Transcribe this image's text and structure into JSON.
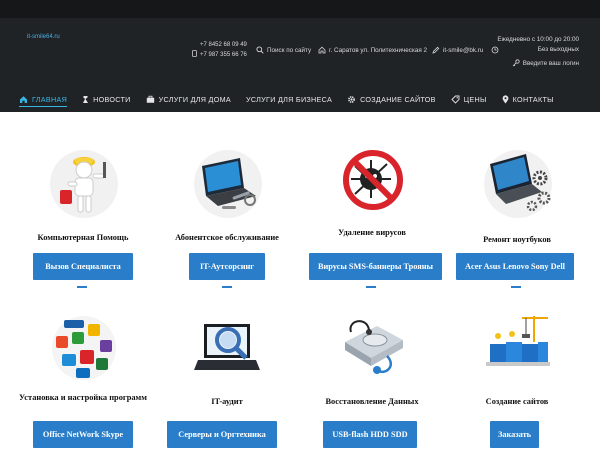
{
  "header": {
    "logo": "it-smile64.ru",
    "phones": [
      "+7 8452 68 09 49",
      "+7 987 355 66 76"
    ],
    "search_label": "Поиск по сайту",
    "address": "г. Саратов ул. Политехническая 2",
    "email": "it-smile@bk.ru",
    "hours": "Ежедневно с 10:00 до 20:00",
    "days_off": "Без выходных",
    "login_label": "Введите ваш логин"
  },
  "nav": {
    "items": [
      {
        "label": "ГЛАВНАЯ",
        "icon": "home-icon",
        "active": true
      },
      {
        "label": "НОВОСТИ",
        "icon": "news-icon",
        "active": false
      },
      {
        "label": "УСЛУГИ ДЛЯ ДОМА",
        "icon": "briefcase-icon",
        "active": false
      },
      {
        "label": "УСЛУГИ ДЛЯ БИЗНЕСА",
        "icon": "",
        "active": false
      },
      {
        "label": "СОЗДАНИЕ САЙТОВ",
        "icon": "gear-icon",
        "active": false
      },
      {
        "label": "ЦЕНЫ",
        "icon": "tag-icon",
        "active": false
      },
      {
        "label": "КОНТАКТЫ",
        "icon": "map-marker-icon",
        "active": false
      }
    ]
  },
  "services": [
    {
      "title": "Компьютерная Помощь",
      "button": "Вызов Специалиста",
      "image": "robot-repair-image"
    },
    {
      "title": "Абонентское обслуживание",
      "button": "IT-Аутсорсинг",
      "image": "laptop-tools-image"
    },
    {
      "title": "Удаление вирусов",
      "button": "Вирусы SMS-баннеры Трояны",
      "image": "virus-forbidden-image"
    },
    {
      "title": "Ремонт ноутбуков",
      "button": "Acer Asus Lenovo Sony Dell",
      "image": "laptop-gears-image"
    },
    {
      "title": "Установка и настройка программ",
      "button": "Office NetWork Skype",
      "image": "software-icons-image"
    },
    {
      "title": "IT-аудит",
      "button": "Серверы и Оргтехника",
      "image": "laptop-magnifier-image"
    },
    {
      "title": "Восстановление Данных",
      "button": "USB-flash HDD SDD",
      "image": "hard-drive-stethoscope-image"
    },
    {
      "title": "Создание сайтов",
      "button": "Заказать",
      "image": "web-construction-image"
    }
  ],
  "colors": {
    "header_bg": "#1f2326",
    "accent": "#37b6e6",
    "button": "#2a7ec9"
  }
}
